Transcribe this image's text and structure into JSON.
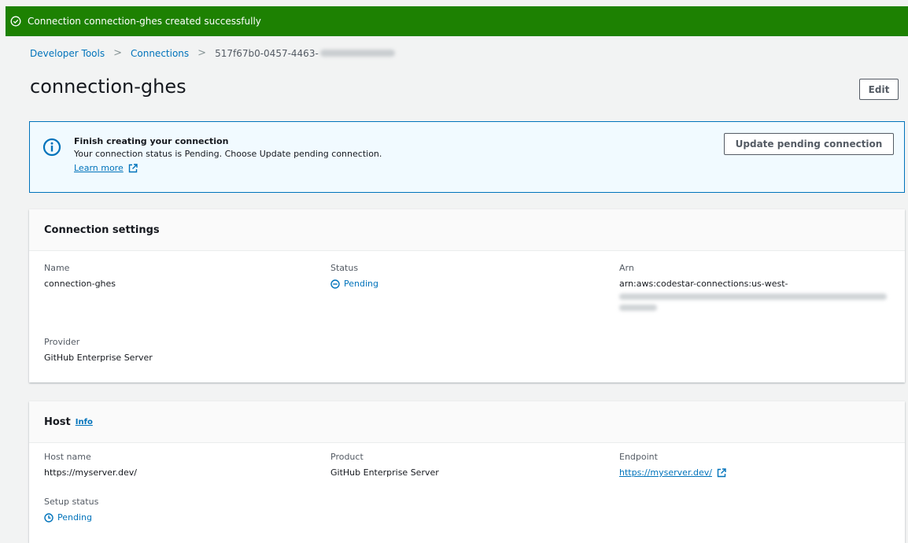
{
  "flash": {
    "message": "Connection connection-ghes created successfully"
  },
  "breadcrumb": {
    "items": [
      "Developer Tools",
      "Connections"
    ],
    "current": "517f67b0-0457-4463-"
  },
  "page": {
    "title": "connection-ghes",
    "edit_label": "Edit"
  },
  "alert": {
    "title": "Finish creating your connection",
    "body": "Your connection status is Pending. Choose Update pending connection.",
    "link": "Learn more",
    "button": "Update pending connection"
  },
  "settings": {
    "header": "Connection settings",
    "name_label": "Name",
    "name_value": "connection-ghes",
    "status_label": "Status",
    "status_value": "Pending",
    "arn_label": "Arn",
    "arn_value": "arn:aws:codestar-connections:us-west-",
    "provider_label": "Provider",
    "provider_value": "GitHub Enterprise Server"
  },
  "host": {
    "header": "Host",
    "info_link": "Info",
    "hostname_label": "Host name",
    "hostname_value": "https://myserver.dev/",
    "product_label": "Product",
    "product_value": "GitHub Enterprise Server",
    "endpoint_label": "Endpoint",
    "endpoint_value": "https://myserver.dev/",
    "setup_label": "Setup status",
    "setup_value": "Pending"
  },
  "colors": {
    "success": "#1d8102",
    "link": "#0073bb",
    "alert_bg": "#f1faff",
    "page_bg": "#f2f3f3"
  },
  "icons": [
    "check-circle-icon",
    "info-icon",
    "external-link-icon",
    "pending-icon",
    "clock-icon"
  ]
}
